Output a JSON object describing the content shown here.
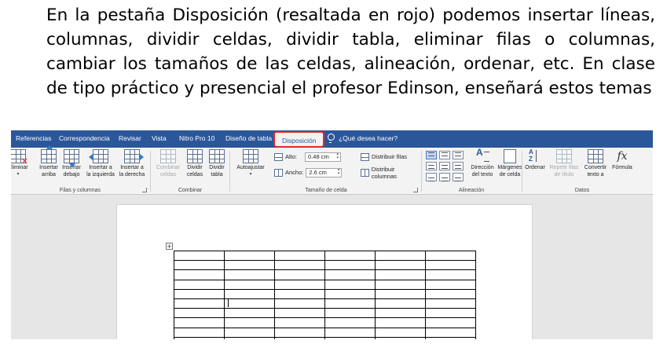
{
  "caption": "En la pestaña Disposición (resaltada en rojo) podemos insertar líneas, columnas, dividir celdas, dividir tabla, eliminar filas o columnas, cambiar los tamaños de las celdas, alineación, ordenar, etc. En clase de tipo práctico y presencial el profesor Edinson, enseñará estos temas",
  "tabs": [
    "Referencias",
    "Correspondencia",
    "Revisar",
    "Vista",
    "Nitro Pro 10",
    "Diseño de tabla",
    "Disposición"
  ],
  "active_tab": "Disposición",
  "tell_me": "¿Qué desea hacer?",
  "colors": {
    "tab_bar": "#2b579a",
    "highlight": "#e5262a",
    "ribbon": "#f3f3f3"
  },
  "groups": {
    "filas_columnas": {
      "label": "Filas y columnas",
      "eliminar": [
        "Eliminar"
      ],
      "insertar_arriba": [
        "Insertar",
        "arriba"
      ],
      "insertar_debajo": [
        "Insertar",
        "debajo"
      ],
      "insertar_izquierda": [
        "Insertar a",
        "la izquierda"
      ],
      "insertar_derecha": [
        "Insertar a",
        "la derecha"
      ]
    },
    "combinar": {
      "label": "Combinar",
      "combinar_celdas": [
        "Combinar",
        "celdas"
      ],
      "dividir_celdas": [
        "Dividir",
        "celdas"
      ],
      "dividir_tabla": [
        "Dividir",
        "tabla"
      ]
    },
    "tamano": {
      "label": "Tamaño de celda",
      "autoajustar": "Autoajustar",
      "alto_label": "Alto:",
      "alto_value": "0.48 cm",
      "ancho_label": "Ancho:",
      "ancho_value": "2.6 cm",
      "distribuir_filas": "Distribuir filas",
      "distribuir_columnas": "Distribuir columnas"
    },
    "alineacion": {
      "label": "Alineación",
      "direccion": [
        "Dirección",
        "del texto"
      ],
      "margenes": [
        "Márgenes",
        "de celda"
      ]
    },
    "datos": {
      "label": "Datos",
      "ordenar": "Ordenar",
      "repetir": [
        "Repetir filas",
        "de título"
      ],
      "convertir": [
        "Convertir",
        "texto a"
      ],
      "formula": "Fórmula"
    }
  },
  "table": {
    "rows": 10,
    "cols": 6
  }
}
